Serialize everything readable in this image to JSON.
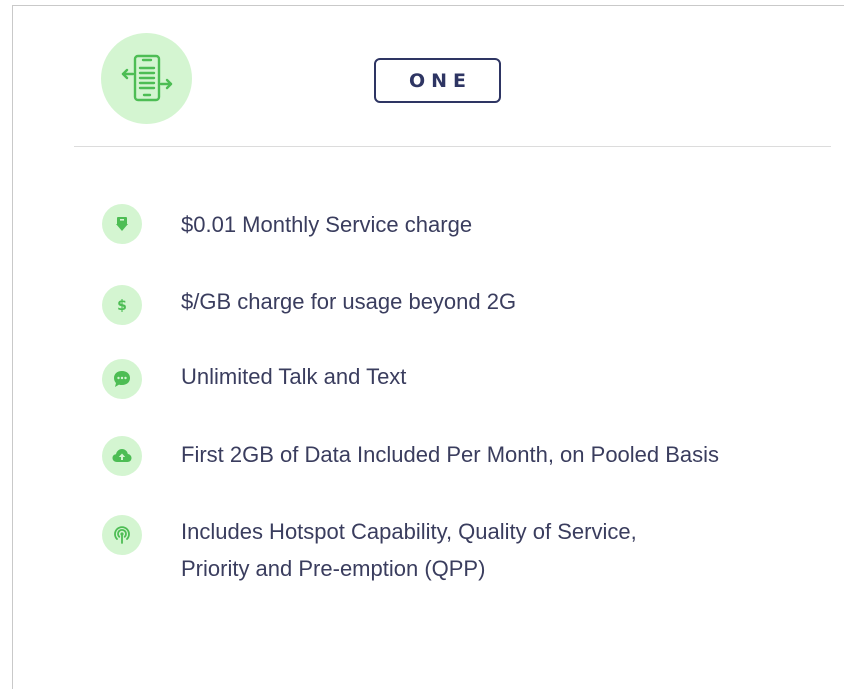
{
  "plan": {
    "badge_label": "ONE",
    "hero_icon": "phone-transfer-icon",
    "accent_color": "#4dbd54",
    "icon_bg_color": "#d4f5d1",
    "text_color": "#3a3d5e"
  },
  "features": [
    {
      "icon": "money-down-icon",
      "text": "$0.01 Monthly Service charge"
    },
    {
      "icon": "dollar-icon",
      "text": "$/GB charge for usage beyond 2G"
    },
    {
      "icon": "chat-bubble-icon",
      "text": "Unlimited Talk and Text"
    },
    {
      "icon": "cloud-upload-icon",
      "text": "First 2GB of Data Included Per Month, on Pooled Basis"
    },
    {
      "icon": "hotspot-icon",
      "text": "Includes Hotspot Capability, Quality of Service,\nPriority and Pre-emption (QPP)"
    }
  ]
}
